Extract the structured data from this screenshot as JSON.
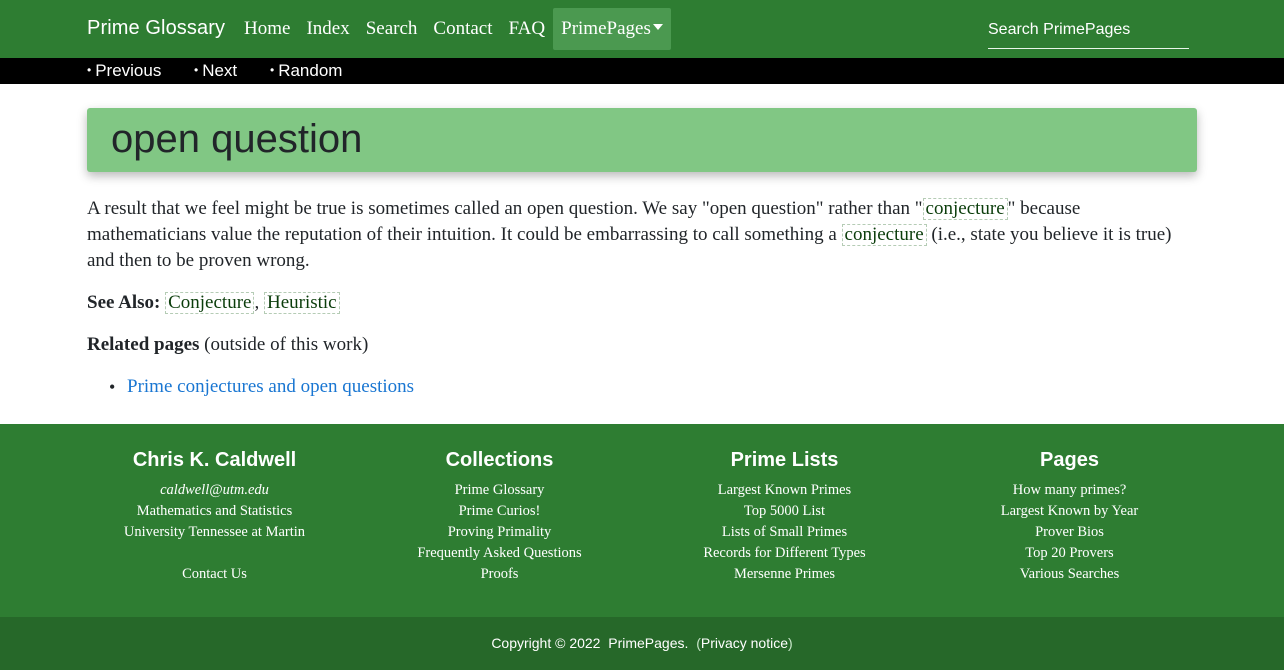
{
  "navbar": {
    "brand": "Prime Glossary",
    "links": [
      "Home",
      "Index",
      "Search",
      "Contact",
      "FAQ"
    ],
    "dropdown_label": "PrimePages",
    "search_placeholder": "Search PrimePages"
  },
  "subnav": {
    "items": [
      "Previous",
      "Next",
      "Random"
    ],
    "bullet": "•"
  },
  "entry": {
    "title": "open question",
    "definition": {
      "part1": "A result that we feel might be true is sometimes called an open question. We say \"open question\" rather than \"",
      "term1": "conjecture",
      "part2": "\" because mathematicians value the reputation of their intuition. It could be embarrassing to call something a ",
      "term2": "conjecture",
      "part3": " (i.e., state you believe it is true) and then to be proven wrong."
    },
    "see_also_label": "See Also:",
    "see_also": [
      "Conjecture",
      "Heuristic"
    ],
    "see_also_sep": ",",
    "related_label": "Related pages",
    "related_suffix": " (outside of this work)",
    "related_links": [
      "Prime conjectures and open questions"
    ]
  },
  "footer": {
    "columns": [
      {
        "title": "Chris K. Caldwell",
        "email": "caldwell@utm.edu",
        "lines": [
          "Mathematics and Statistics",
          "University Tennessee at Martin"
        ],
        "contact": "Contact Us"
      },
      {
        "title": "Collections",
        "lines": [
          "Prime Glossary",
          "Prime Curios!",
          "Proving Primality",
          "Frequently Asked Questions",
          "Proofs"
        ]
      },
      {
        "title": "Prime Lists",
        "lines": [
          "Largest Known Primes",
          "Top 5000 List",
          "Lists of Small Primes",
          "Records for Different Types",
          "Mersenne Primes"
        ]
      },
      {
        "title": "Pages",
        "lines": [
          "How many primes?",
          "Largest Known by Year",
          "Prover Bios",
          "Top 20 Provers",
          "Various Searches"
        ]
      }
    ],
    "copyright": "Copyright © 2022",
    "site": "PrimePages.",
    "privacy": "Privacy notice",
    "paren_open": "(",
    "paren_close": ")"
  },
  "colors": {
    "navbar": "#2e7d32",
    "title_card": "#81c784",
    "link": "#1976d2",
    "subnav": "#000000",
    "footer_bottom": "#266829"
  }
}
